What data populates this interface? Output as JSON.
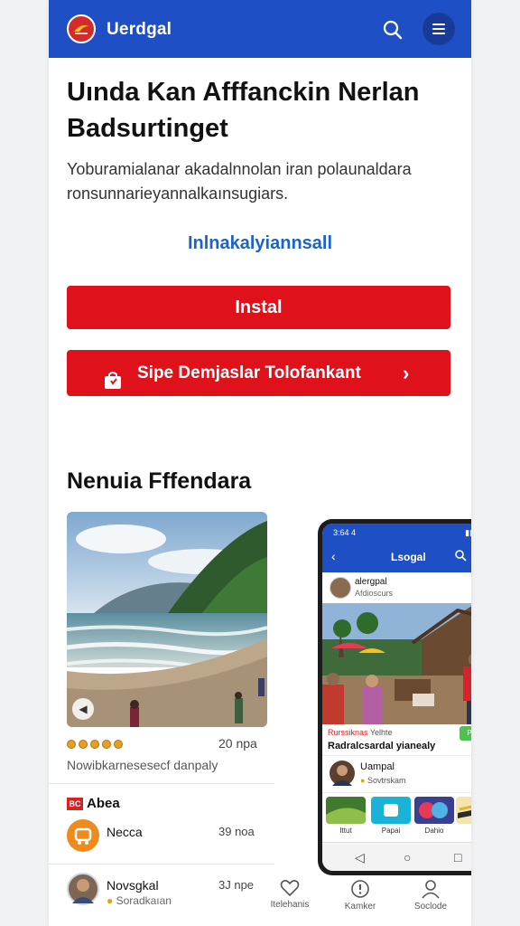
{
  "header": {
    "brand": "Uerdgal",
    "colors": {
      "bar": "#1f4fc4",
      "accent": "#df111a"
    },
    "icons": [
      "logo-icon",
      "search-icon",
      "menu-icon"
    ]
  },
  "hero": {
    "headline": "Uında Kan Afffanckin Nerlan Badsurtinget",
    "description": "Yoburamialanar akadalnnolan iran polaunaldara ronsunnarieyannalkaınsugiars.",
    "link": "Inlnakalyiannsall",
    "install_label": "Instal",
    "secondary_label": "Sipe Demjaslar Tolofankant",
    "secondary_chevron": "›"
  },
  "featured": {
    "title": "Nenuia Fffendara",
    "count": "20 npa",
    "caption": "Nowibkarnesesecf danpaly",
    "rating_dots": 5
  },
  "list": {
    "head_icon": "BC",
    "head": "Abea",
    "items": [
      {
        "name": "Necca",
        "sub": "",
        "time": "39 noa"
      },
      {
        "name": "Novsgkal",
        "sub": "Soradkaıan",
        "time": "3J npe"
      }
    ]
  },
  "bottom_nav": [
    {
      "label": "Itelehanis",
      "icon": "heart-icon"
    },
    {
      "label": "Kamker",
      "icon": "alert-icon"
    },
    {
      "label": "Soclode",
      "icon": "profile-icon"
    }
  ],
  "phone": {
    "status_time": "3:64 4",
    "app_title": "Lsogal",
    "post_user": "alergpal",
    "post_user_sub": "Afdioscurs",
    "tag": "Rurssiknas",
    "tag2": "Yelhte",
    "pill": "Purb",
    "post_title": "Radralcsardal yianealy",
    "row_name": "Uampal",
    "row_sub": "Sovtrskam",
    "thumbs": [
      "Ittut",
      "Papai",
      "Dahio",
      ""
    ],
    "sys_nav": [
      "◁",
      "○",
      "□"
    ]
  }
}
